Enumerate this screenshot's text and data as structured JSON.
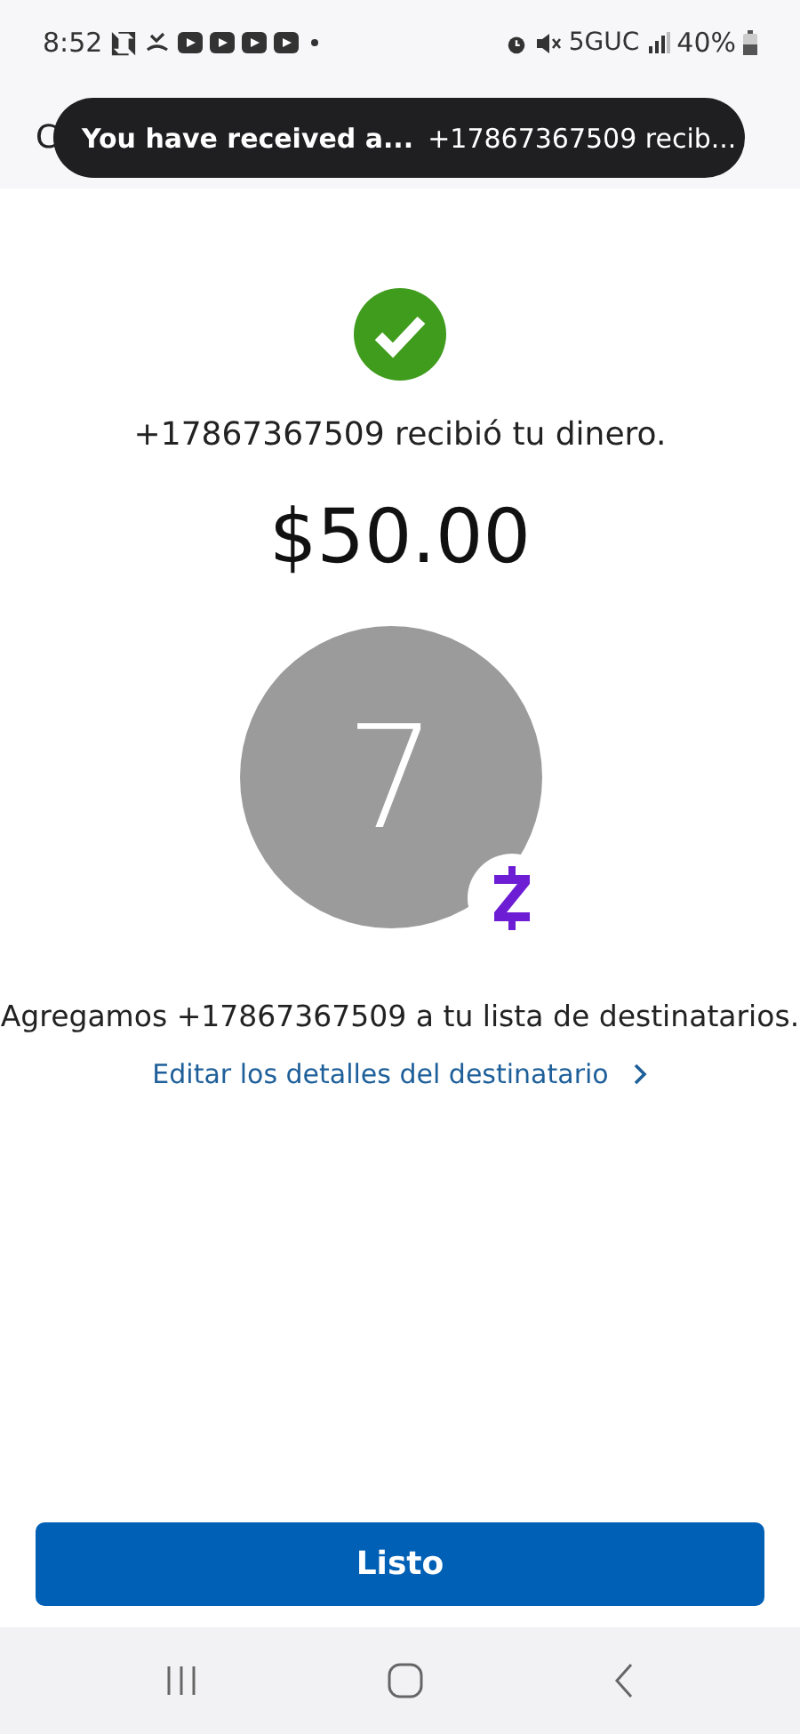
{
  "status_bar": {
    "time": "8:52",
    "network": "5GUC",
    "battery": "40%"
  },
  "header": {
    "title": "C"
  },
  "notification": {
    "title": "You have received a...",
    "body": "+17867367509 recib..."
  },
  "confirmation": {
    "message": "+17867367509 recibió tu dinero.",
    "amount": "$50.00"
  },
  "recipient": {
    "initial": "7",
    "added_message": "Agregamos +17867367509 a tu lista de destinatarios.",
    "edit_link": "Editar los detalles del destinatario"
  },
  "done_button": "Listo"
}
